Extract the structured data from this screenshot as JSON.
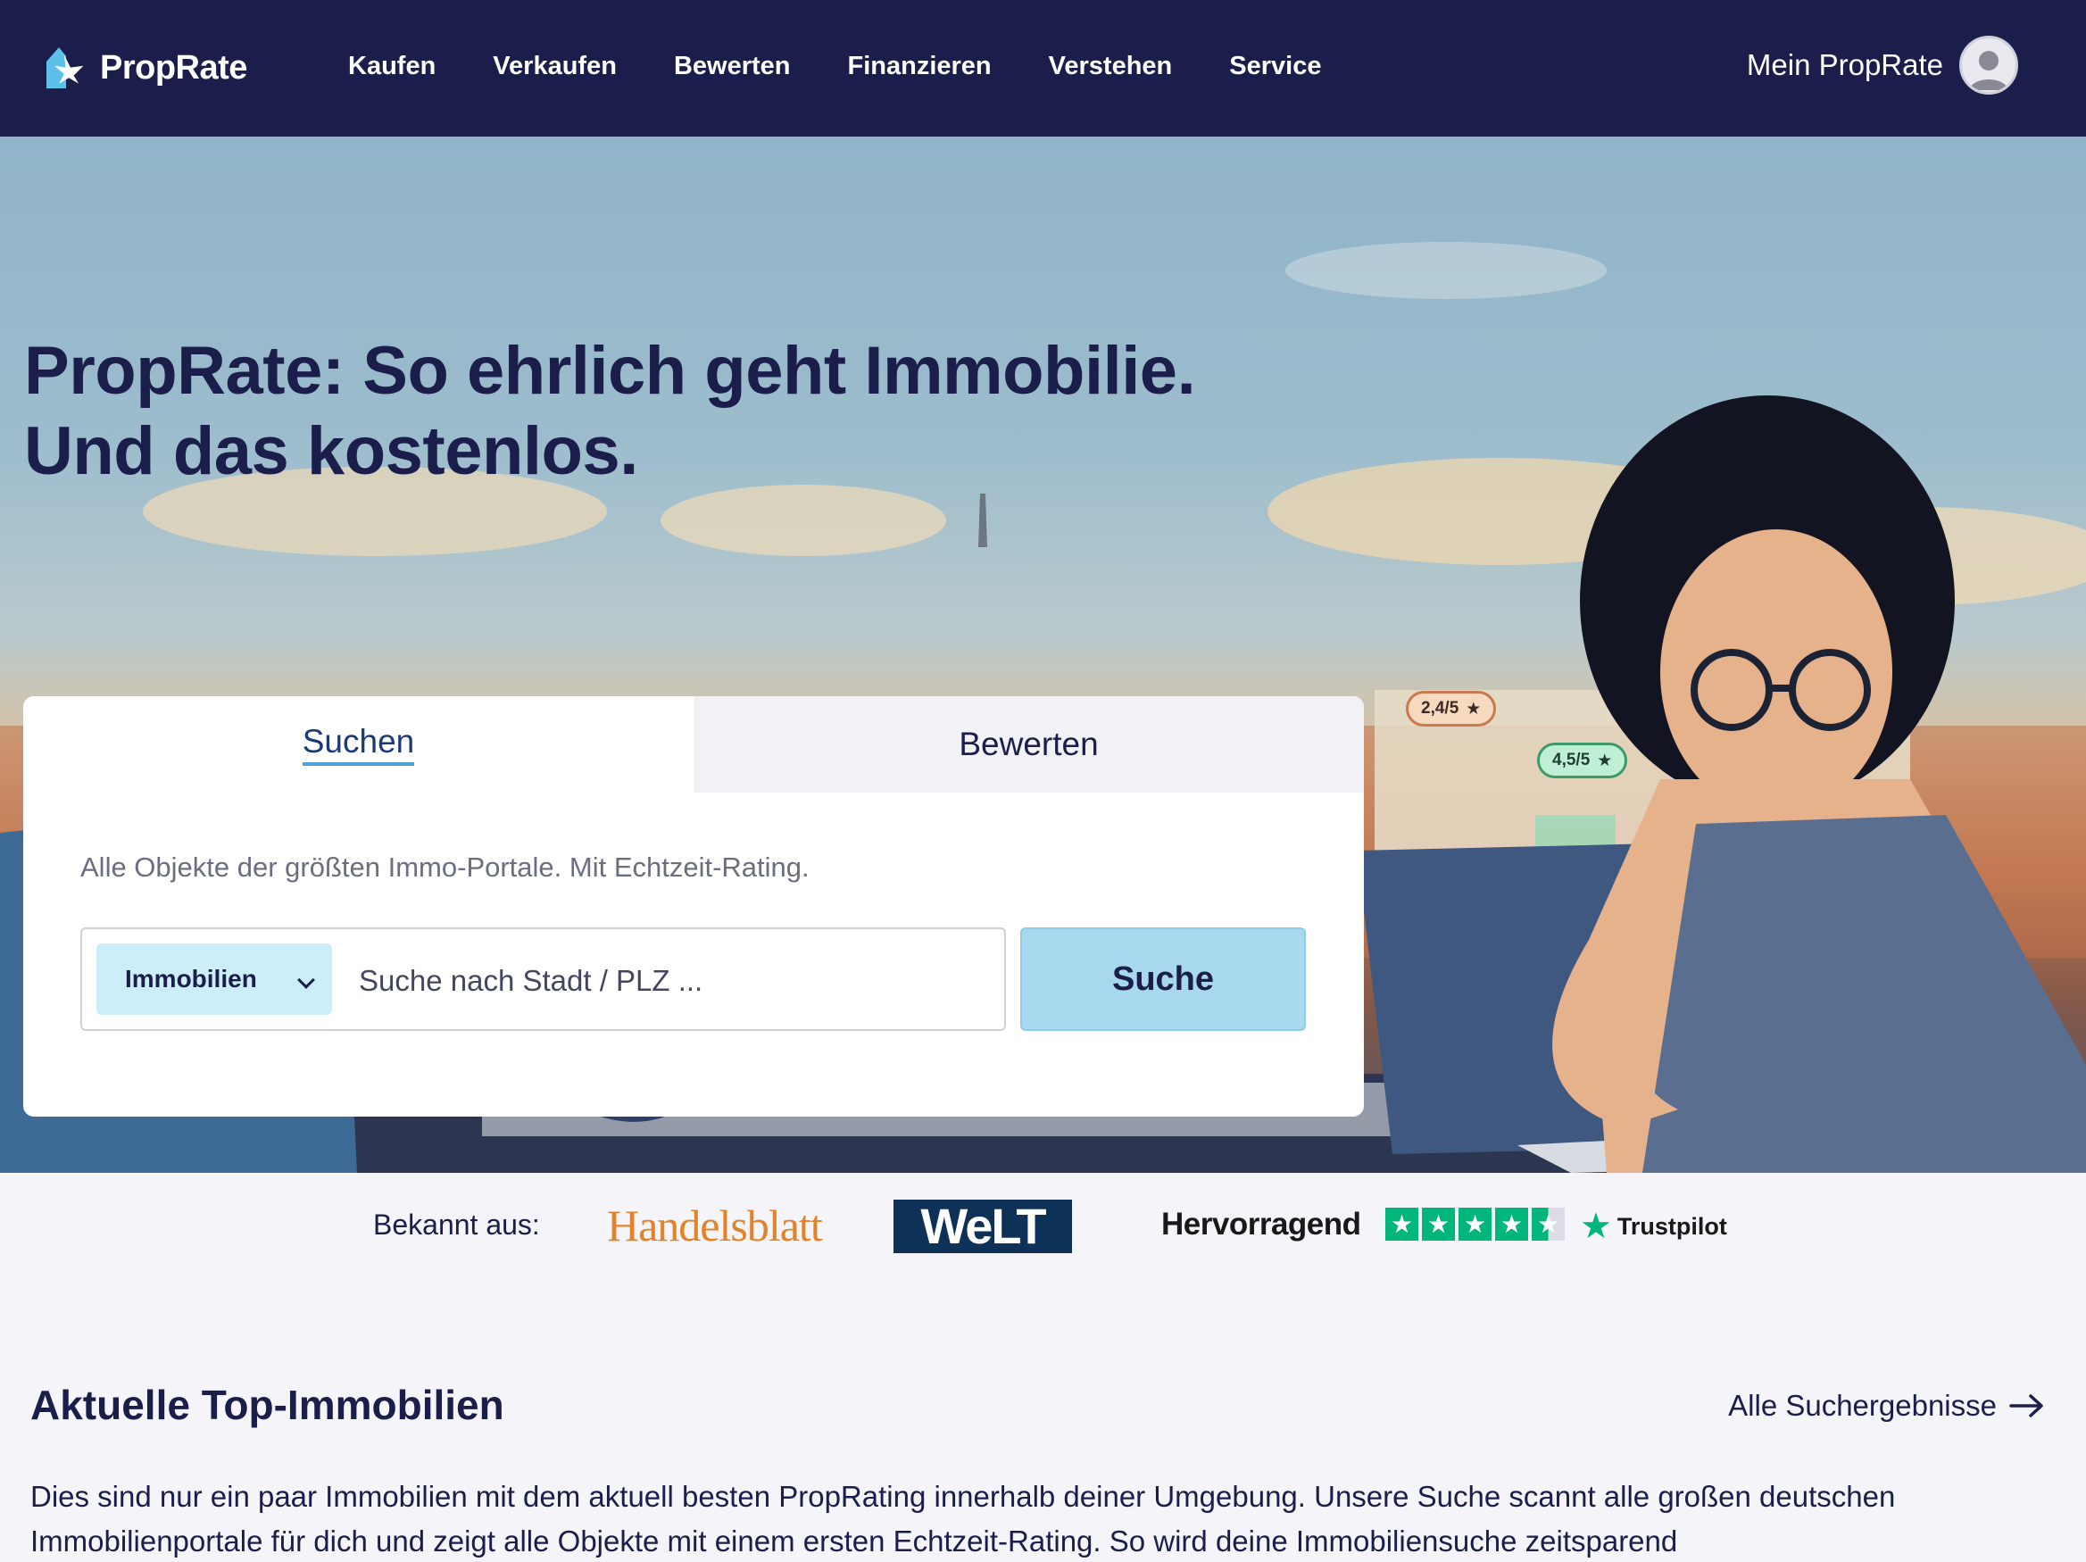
{
  "header": {
    "logo_text": "PropRate",
    "nav": [
      "Kaufen",
      "Verkaufen",
      "Bewerten",
      "Finanzieren",
      "Verstehen",
      "Service"
    ],
    "account_label": "Mein PropRate",
    "colors": {
      "background": "#1b1e4b",
      "text": "#ffffff"
    }
  },
  "hero": {
    "headline_line1": "PropRate: So ehrlich geht Immobilie.",
    "headline_line2": "Und das kostenlos.",
    "ratings": [
      "2,4/5",
      "4,5/5"
    ]
  },
  "search_card": {
    "tabs": [
      {
        "label": "Suchen",
        "active": true
      },
      {
        "label": "Bewerten",
        "active": false
      }
    ],
    "subtitle": "Alle Objekte der größten Immo-Portale. Mit Echtzeit-Rating.",
    "type_select": "Immobilien",
    "input_placeholder": "Suche nach Stadt / PLZ ...",
    "button_label": "Suche",
    "colors": {
      "button": "#a7d8ee",
      "select": "#cbeef9"
    }
  },
  "trust_bar": {
    "label": "Bekannt aus:",
    "press": [
      "Handelsblatt",
      "WeLT"
    ],
    "trustpilot_rating_text": "Hervorragend",
    "trustpilot_stars": 4.5,
    "trustpilot_brand": "Trustpilot",
    "colors": {
      "trustpilot_green": "#00b67a",
      "handelsblatt": "#e0832a",
      "welt": "#0e3157"
    }
  },
  "top_properties": {
    "title": "Aktuelle Top-Immobilien",
    "link_label": "Alle Suchergebnisse",
    "description": "Dies sind nur ein paar Immobilien mit dem aktuell besten PropRating innerhalb deiner Umgebung. Unsere Suche scannt alle großen deutschen Immobilienportale für dich und zeigt alle Objekte mit einem ersten Echtzeit-Rating. So wird deine Immobiliensuche zeitsparend"
  }
}
